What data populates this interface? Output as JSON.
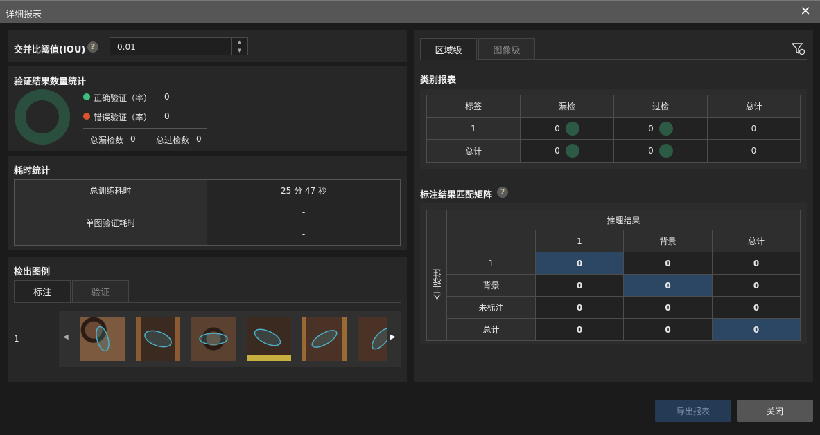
{
  "window": {
    "title": "详细报表",
    "close_icon": "close-icon"
  },
  "iou": {
    "label": "交并比阈值(IOU)",
    "help": "?",
    "value": "0.01"
  },
  "stats": {
    "title": "验证结果数量统计",
    "correct_label": "正确验证（率）",
    "correct_value": "0",
    "correct_color": "#3fbf7f",
    "wrong_label": "错误验证（率）",
    "wrong_value": "0",
    "wrong_color": "#d9532c",
    "total_miss_label": "总漏检数",
    "total_miss_value": "0",
    "total_over_label": "总过检数",
    "total_over_value": "0",
    "donut_color": "#2a4f3f"
  },
  "time": {
    "title": "耗时统计",
    "train_label": "总训练耗时",
    "train_value": "25 分 47 秒",
    "single_label": "单图验证耗时",
    "single_value_1": "-",
    "single_value_2": "-"
  },
  "examples": {
    "title": "检出图例",
    "tabs": [
      "标注",
      "验证"
    ],
    "row_label": "1",
    "prev_icon": "chevron-left-icon",
    "next_icon": "chevron-right-icon"
  },
  "right_tabs": [
    "区域级",
    "图像级"
  ],
  "filter_icon": "filter-icon",
  "category_report": {
    "title": "类别报表",
    "headers": [
      "标签",
      "漏检",
      "过检",
      "总计"
    ],
    "rows": [
      {
        "label": "1",
        "miss": "0",
        "over": "0",
        "total": "0"
      },
      {
        "label": "总计",
        "miss": "0",
        "over": "0",
        "total": "0"
      }
    ]
  },
  "matrix": {
    "title": "标注结果匹配矩阵",
    "help": "?",
    "top_header": "推理结果",
    "side_header": "人工标注",
    "col_headers": [
      "1",
      "背景",
      "总计"
    ],
    "rows": [
      {
        "label": "1",
        "values": [
          "0",
          "0",
          "0"
        ]
      },
      {
        "label": "背景",
        "values": [
          "0",
          "0",
          "0"
        ]
      },
      {
        "label": "未标注",
        "values": [
          "0",
          "0",
          "0"
        ]
      },
      {
        "label": "总计",
        "values": [
          "0",
          "0",
          "0"
        ]
      }
    ],
    "highlight_color": "#2b4764"
  },
  "buttons": {
    "export": "导出报表",
    "close": "关闭"
  }
}
